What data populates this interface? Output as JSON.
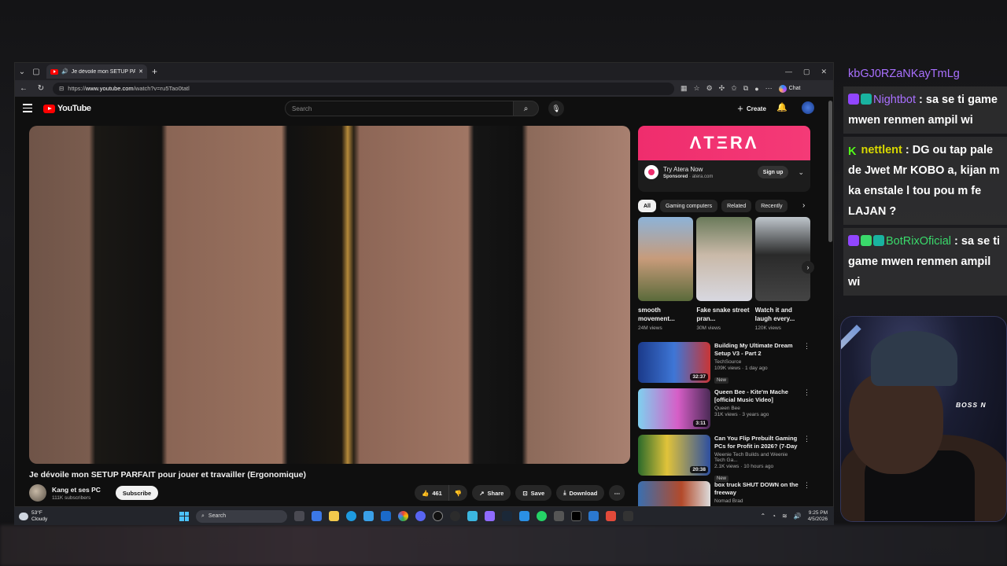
{
  "browser": {
    "tab_title": "Je dévoile mon SETUP PARFAIT",
    "url_prefix": "https://",
    "url_host": "www.youtube.com",
    "url_path": "/watch?v=ru5Tao0tatl",
    "chat_label": "Chat"
  },
  "youtube": {
    "logo_text": "YouTube",
    "search_placeholder": "Search",
    "create_label": "Create"
  },
  "video": {
    "title": "Je dévoile mon SETUP PARFAIT pour jouer et travailler (Ergonomique)",
    "channel": "Kang et ses PC",
    "subscribers": "111K subscribers",
    "subscribe_label": "Subscribe",
    "likes": "461",
    "share_label": "Share",
    "save_label": "Save",
    "download_label": "Download"
  },
  "ad": {
    "banner": "ΛTΞRΛ",
    "title": "Try Atera Now",
    "sponsored": "Sponsored",
    "domain": "atera.com",
    "cta": "Sign up"
  },
  "chips": [
    "All",
    "Gaming computers",
    "Related",
    "Recently"
  ],
  "shorts": [
    {
      "title": "smooth movement...",
      "views": "24M views",
      "color": "linear-gradient(180deg,#8db3d8,#c79b7a 50%,#5a6a3a)"
    },
    {
      "title": "Fake snake street pran...",
      "views": "30M views",
      "color": "linear-gradient(180deg,#6a7a5a,#c9b9a8 45%,#d8d8e0)"
    },
    {
      "title": "Watch it and laugh every...",
      "views": "120K views",
      "color": "linear-gradient(180deg,#bfc6cc,#2a2a2a 45%,#444)"
    }
  ],
  "recs": [
    {
      "title": "Building My Ultimate Dream Setup V3 - Part 2",
      "channel": "TechSource",
      "meta": "109K views · 1 day ago",
      "badge": "New",
      "duration": "32:37",
      "color": "linear-gradient(90deg,#1b3a8a,#3e76d6 50%,#c93535)"
    },
    {
      "title": "Queen Bee - Kite'm Mache [official Music Video]",
      "channel": "Queen Bee",
      "meta": "31K views · 3 years ago",
      "badge": "",
      "duration": "3:11",
      "color": "linear-gradient(90deg,#7fd0ef,#d65ec7 55%,#4a2a55)"
    },
    {
      "title": "Can You Flip Prebuilt Gaming PCs for Profit in 2026? (7-Day ...",
      "channel": "Weenie Tech Builds and Weenie Tech Ga...",
      "meta": "2.1K views · 10 hours ago",
      "badge": "New",
      "duration": "20:38",
      "color": "linear-gradient(90deg,#2b6a2b,#e0c33a 40%,#2d4fa0)"
    },
    {
      "title": "box truck SHUT DOWN on the freeway",
      "channel": "Nomad Brad",
      "meta": "",
      "badge": "",
      "duration": "",
      "color": "linear-gradient(90deg,#3a6fb0,#b34a2a 60%,#dcdcdc)"
    }
  ],
  "taskbar": {
    "temp": "53°F",
    "weather": "Cloudy",
    "search_label": "Search",
    "time": "9:25 PM",
    "date": "4/5/2026"
  },
  "chat": {
    "top_user": "kbGJ0RZaNKayTmLg",
    "messages": [
      {
        "user": "Nightbot",
        "text": " : sa se ti game mwen renmen ampil wi"
      },
      {
        "user": "nettlent",
        "text": " : DG ou tap pale de Jwet Mr KOBO a, kijan m ka enstale l tou pou m fe LAJAN ?"
      },
      {
        "user": "BotRixOficial",
        "text": " : sa se ti game mwen renmen ampil wi"
      }
    ]
  },
  "webcam": {
    "label": "BOSS N"
  }
}
